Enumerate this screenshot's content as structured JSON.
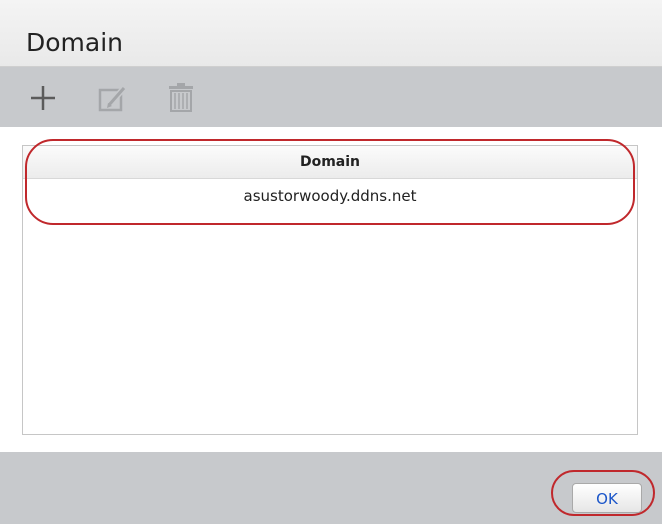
{
  "dialog": {
    "title": "Domain"
  },
  "toolbar": {
    "icons": [
      "plus-icon",
      "edit-icon",
      "trash-icon"
    ]
  },
  "table": {
    "column_header": "Domain",
    "rows": [
      {
        "domain": "asustorwoody.ddns.net"
      }
    ]
  },
  "footer": {
    "ok_label": "OK"
  },
  "colors": {
    "highlight": "#c0282c",
    "ok_text": "#1a55c9",
    "toolbar_bg": "#c7c9cc"
  }
}
